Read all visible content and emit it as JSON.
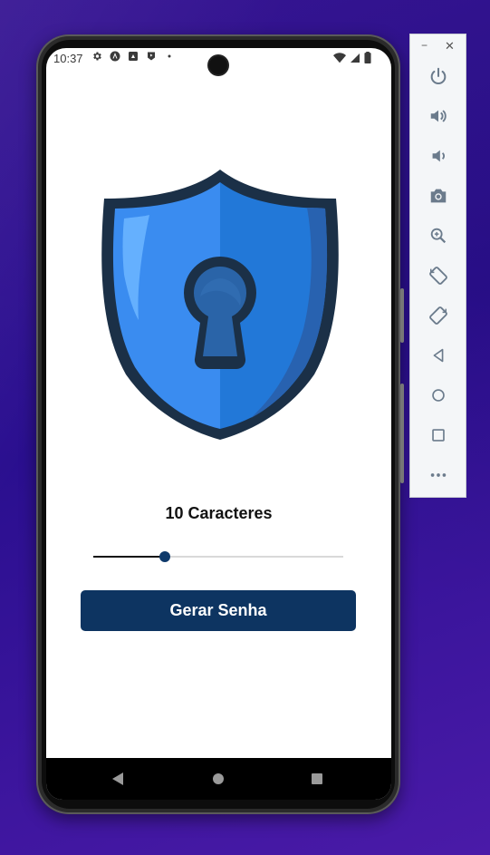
{
  "status_bar": {
    "time": "10:37"
  },
  "app": {
    "heading": "10 Caracteres",
    "slider": {
      "min": 6,
      "max": 20,
      "value": 10
    },
    "generate_button_label": "Gerar Senha"
  },
  "colors": {
    "button_bg": "#0d3461",
    "shield_light": "#3a8cf0",
    "shield_dark": "#2278d8",
    "shield_outline": "#1b3047"
  },
  "emulator_toolbar": {
    "minimize_label": "−",
    "close_label": "✕",
    "items": [
      "power-icon",
      "volume-up-icon",
      "volume-down-icon",
      "camera-icon",
      "zoom-icon",
      "rotate-left-icon",
      "rotate-right-icon",
      "back-icon",
      "home-icon",
      "overview-icon",
      "more-icon"
    ]
  },
  "nav_bar": {
    "items": [
      "back-icon",
      "home-icon",
      "overview-icon"
    ]
  }
}
